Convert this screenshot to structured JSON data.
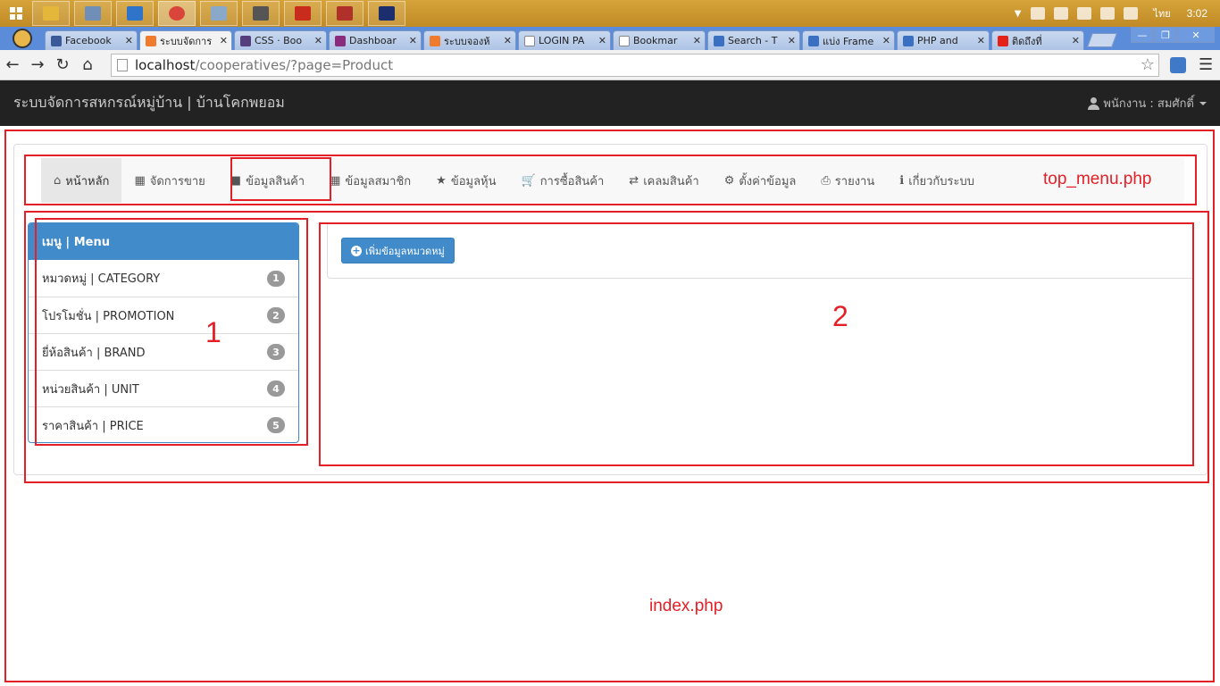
{
  "os": {
    "tray": {
      "language": "ไทย",
      "clock": "3:02"
    },
    "taskbar_apps": [
      {
        "name": "file-explorer",
        "color": "#e4b73a"
      },
      {
        "name": "email",
        "color": "#6f8fb8"
      },
      {
        "name": "internet-explorer",
        "color": "#2f74c8"
      },
      {
        "name": "chrome",
        "color": "#d9453b"
      },
      {
        "name": "notepad",
        "color": "#8aa9c9"
      },
      {
        "name": "media",
        "color": "#555555"
      },
      {
        "name": "acrobat",
        "color": "#c92b1d"
      },
      {
        "name": "filezilla",
        "color": "#b0302a"
      },
      {
        "name": "photoshop",
        "color": "#1d2e6e"
      }
    ]
  },
  "browser": {
    "tabs": [
      {
        "title": "Facebook",
        "color": "#3b5998",
        "active": false
      },
      {
        "title": "ระบบจัดการ",
        "color": "#f07b2c",
        "active": true
      },
      {
        "title": "CSS · Boo",
        "color": "#563d7c",
        "active": false
      },
      {
        "title": "Dashboar",
        "color": "#8b2b7e",
        "active": false
      },
      {
        "title": "ระบบจองห้",
        "color": "#f07b2c",
        "active": false
      },
      {
        "title": "LOGIN PA",
        "color": "#ffffff",
        "active": false
      },
      {
        "title": "Bookmar",
        "color": "#ffffff",
        "active": false
      },
      {
        "title": "Search - T",
        "color": "#3a6fc2",
        "active": false
      },
      {
        "title": "แบ่ง Frame",
        "color": "#3a6fc2",
        "active": false
      },
      {
        "title": "PHP and",
        "color": "#3a6fc2",
        "active": false
      },
      {
        "title": "ติดถึงที่",
        "color": "#e62117",
        "active": false
      }
    ],
    "url_host": "localhost",
    "url_path": "/cooperatives/?page=Product"
  },
  "navbar": {
    "brand": "ระบบจัดการสหกรณ์หมู่บ้าน | บ้านโคกพยอม",
    "user": "พนักงาน : สมศักดิ์"
  },
  "top_menu": {
    "items": [
      {
        "label": "หน้าหลัก",
        "icon": "home-icon",
        "glyph": "⌂",
        "active": true
      },
      {
        "label": "จัดการขาย",
        "icon": "qrcode-icon",
        "glyph": "▦",
        "active": false
      },
      {
        "label": "ข้อมูลสินค้า",
        "icon": "th-large-icon",
        "glyph": "■",
        "active": false
      },
      {
        "label": "ข้อมูลสมาชิก",
        "icon": "th-icon",
        "glyph": "▦",
        "active": false
      },
      {
        "label": "ข้อมูลหุ้น",
        "icon": "star-icon",
        "glyph": "★",
        "active": false
      },
      {
        "label": "การซื้อสินค้า",
        "icon": "cart-icon",
        "glyph": "🛒",
        "active": false
      },
      {
        "label": "เคลมสินค้า",
        "icon": "retweet-icon",
        "glyph": "⇄",
        "active": false
      },
      {
        "label": "ตั้งค่าข้อมูล",
        "icon": "cog-icon",
        "glyph": "⚙",
        "active": false
      },
      {
        "label": "รายงาน",
        "icon": "print-icon",
        "glyph": "⎙",
        "active": false
      },
      {
        "label": "เกี่ยวกับระบบ",
        "icon": "info-icon",
        "glyph": "ℹ",
        "active": false
      }
    ]
  },
  "side_menu": {
    "title": "เมนู | Menu",
    "items": [
      {
        "label": "หมวดหมู่ | CATEGORY",
        "badge": "1"
      },
      {
        "label": "โปรโมชั่น | PROMOTION",
        "badge": "2"
      },
      {
        "label": "ยี่ห้อสินค้า | BRAND",
        "badge": "3"
      },
      {
        "label": "หน่วยสินค้า | UNIT",
        "badge": "4"
      },
      {
        "label": "ราคาสินค้า | PRICE",
        "badge": "5"
      }
    ]
  },
  "content": {
    "add_button": "เพิ่มข้อมูลหมวดหมู่"
  },
  "annotations": {
    "top_menu_label": "top_menu.php",
    "side_label": "1",
    "content_label": "2",
    "index_label": "index.php",
    "color": "#e41f26"
  }
}
